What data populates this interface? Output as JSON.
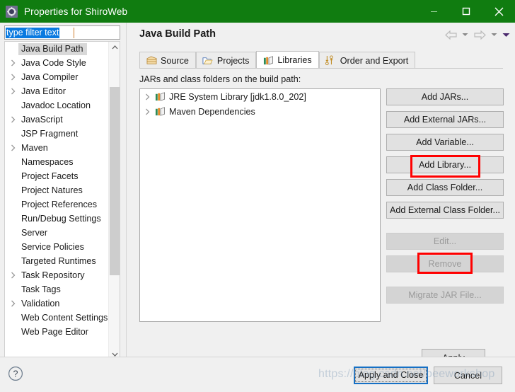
{
  "window": {
    "title": "Properties for ShiroWeb",
    "icon": "gear-icon",
    "minimize": "—",
    "maximize": "□",
    "close": "✕"
  },
  "sidebar": {
    "filter": {
      "value": "type filter text",
      "placeholder": "type filter text"
    },
    "items": [
      {
        "label": "Java Build Path",
        "expandable": false,
        "selected": true
      },
      {
        "label": "Java Code Style",
        "expandable": true,
        "selected": false
      },
      {
        "label": "Java Compiler",
        "expandable": true,
        "selected": false
      },
      {
        "label": "Java Editor",
        "expandable": true,
        "selected": false
      },
      {
        "label": "Javadoc Location",
        "expandable": false,
        "selected": false
      },
      {
        "label": "JavaScript",
        "expandable": true,
        "selected": false
      },
      {
        "label": "JSP Fragment",
        "expandable": false,
        "selected": false
      },
      {
        "label": "Maven",
        "expandable": true,
        "selected": false
      },
      {
        "label": "Namespaces",
        "expandable": false,
        "selected": false
      },
      {
        "label": "Project Facets",
        "expandable": false,
        "selected": false
      },
      {
        "label": "Project Natures",
        "expandable": false,
        "selected": false
      },
      {
        "label": "Project References",
        "expandable": false,
        "selected": false
      },
      {
        "label": "Run/Debug Settings",
        "expandable": false,
        "selected": false
      },
      {
        "label": "Server",
        "expandable": false,
        "selected": false
      },
      {
        "label": "Service Policies",
        "expandable": false,
        "selected": false
      },
      {
        "label": "Targeted Runtimes",
        "expandable": false,
        "selected": false
      },
      {
        "label": "Task Repository",
        "expandable": true,
        "selected": false
      },
      {
        "label": "Task Tags",
        "expandable": false,
        "selected": false
      },
      {
        "label": "Validation",
        "expandable": true,
        "selected": false
      },
      {
        "label": "Web Content Settings",
        "expandable": false,
        "selected": false
      },
      {
        "label": "Web Page Editor",
        "expandable": false,
        "selected": false
      }
    ]
  },
  "content": {
    "page_title": "Java Build Path",
    "nav": {
      "back": "back-arrow-icon",
      "back_menu": "chevron-down-icon",
      "forward": "forward-arrow-icon",
      "forward_menu": "chevron-down-icon",
      "view_menu": "chevron-down-icon"
    },
    "tabs": [
      {
        "label": "Source",
        "icon": "package-icon",
        "active": false
      },
      {
        "label": "Projects",
        "icon": "folder-open-icon",
        "active": false
      },
      {
        "label": "Libraries",
        "icon": "books-icon",
        "active": true
      },
      {
        "label": "Order and Export",
        "icon": "order-arrows-icon",
        "active": false
      }
    ],
    "section_label": "JARs and class folders on the build path:",
    "libraries": [
      {
        "label": "JRE System Library [jdk1.8.0_202]",
        "icon": "books-icon"
      },
      {
        "label": "Maven Dependencies",
        "icon": "books-icon"
      }
    ],
    "buttons": [
      {
        "label": "Add JARs...",
        "enabled": true,
        "highlighted": false
      },
      {
        "label": "Add External JARs...",
        "enabled": true,
        "highlighted": false
      },
      {
        "label": "Add Variable...",
        "enabled": true,
        "highlighted": false
      },
      {
        "label": "Add Library...",
        "enabled": true,
        "highlighted": true
      },
      {
        "label": "Add Class Folder...",
        "enabled": true,
        "highlighted": false
      },
      {
        "label": "Add External Class Folder...",
        "enabled": true,
        "highlighted": false
      },
      {
        "label": "Edit...",
        "enabled": false,
        "highlighted": false
      },
      {
        "label": "Remove",
        "enabled": false,
        "highlighted": true
      },
      {
        "label": "Migrate JAR File...",
        "enabled": false,
        "highlighted": false
      }
    ],
    "apply_label": "Apply"
  },
  "footer": {
    "help": "help-icon",
    "apply_and_close": "Apply and Close",
    "cancel": "Cancel"
  },
  "watermark": "https://blog.csdn.net/beeworkshop",
  "colors": {
    "titlebar": "#107c10",
    "annotation": "#ff0000",
    "focus": "#1670c5",
    "selection": "#0a7ae0"
  }
}
